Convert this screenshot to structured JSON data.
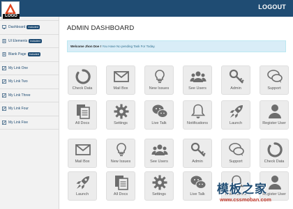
{
  "header": {
    "logo_text": "LOGO",
    "logout_label": "LOGOUT",
    "brand_color": "#1f4c73"
  },
  "sidebar": {
    "items": [
      {
        "label": "Dashboard",
        "badge": "Included",
        "icon": "monitor-icon"
      },
      {
        "label": "UI Elements",
        "badge": "Included",
        "icon": "document-icon"
      },
      {
        "label": "Blank Page",
        "badge": "Included",
        "icon": "document-icon"
      },
      {
        "label": "My Link One",
        "icon": "link-icon"
      },
      {
        "label": "My Link Two",
        "icon": "link-icon"
      },
      {
        "label": "My Link Three",
        "icon": "link-icon"
      },
      {
        "label": "My Link Four",
        "icon": "link-icon"
      },
      {
        "label": "My Link Five",
        "icon": "link-icon"
      }
    ]
  },
  "main": {
    "title": "ADMIN DASHBOARD",
    "welcome_name": "Welcome Jhon Doe !",
    "welcome_msg": "You Have No pending Task For Today.",
    "rows": [
      [
        {
          "label": "Check Data",
          "icon": "circle-progress-icon"
        },
        {
          "label": "Mail Box",
          "icon": "envelope-icon"
        },
        {
          "label": "New Issues",
          "icon": "lightbulb-icon"
        },
        {
          "label": "See Users",
          "icon": "users-icon"
        },
        {
          "label": "Admin",
          "icon": "key-icon"
        },
        {
          "label": "Support",
          "icon": "chat-bubbles-icon"
        }
      ],
      [
        {
          "label": "All Docs",
          "icon": "documents-icon"
        },
        {
          "label": "Settings",
          "icon": "gear-icon"
        },
        {
          "label": "Live Talk",
          "icon": "wechat-icon"
        },
        {
          "label": "Notifications",
          "icon": "bell-icon"
        },
        {
          "label": "Launch",
          "icon": "rocket-icon"
        },
        {
          "label": "Register User",
          "icon": "user-icon"
        }
      ],
      [
        {
          "label": "Mail Box",
          "icon": "envelope-icon"
        },
        {
          "label": "New Issues",
          "icon": "lightbulb-icon"
        },
        {
          "label": "See Users",
          "icon": "users-icon"
        },
        {
          "label": "Admin",
          "icon": "key-icon"
        },
        {
          "label": "Support",
          "icon": "chat-bubbles-icon"
        },
        {
          "label": "Check Data",
          "icon": "circle-progress-icon"
        }
      ],
      [
        {
          "label": "Launch",
          "icon": "rocket-icon"
        },
        {
          "label": "All Docs",
          "icon": "documents-icon"
        },
        {
          "label": "Settings",
          "icon": "gear-icon"
        },
        {
          "label": "Live Talk",
          "icon": "wechat-icon"
        },
        {
          "label": "Notifications",
          "icon": "bell-icon"
        },
        {
          "label": "Register User",
          "icon": "user-icon"
        }
      ]
    ]
  },
  "watermark": {
    "title": "模板之家",
    "url": "www.cssmoban.com"
  }
}
